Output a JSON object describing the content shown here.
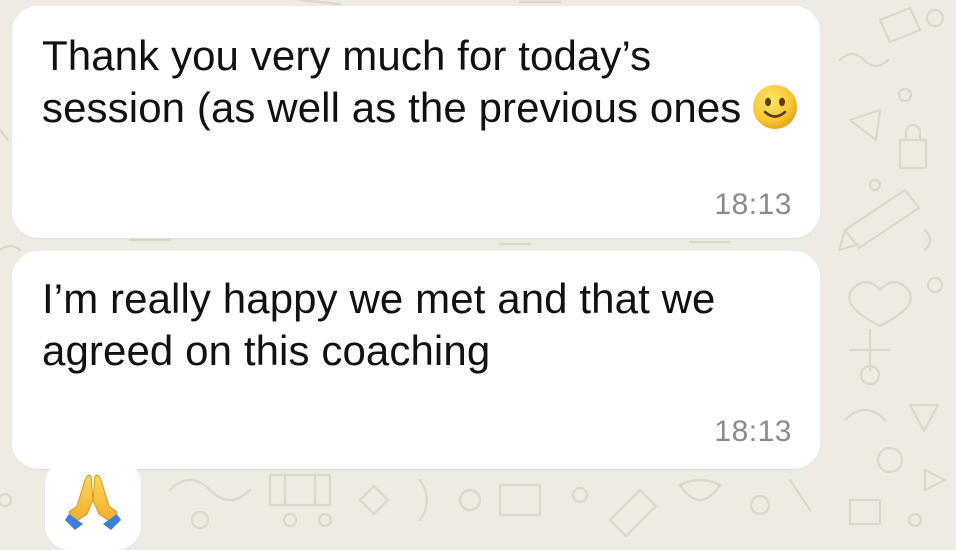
{
  "chat": {
    "background_color": "#efeae2",
    "bubble_color": "#ffffff",
    "messages": [
      {
        "text": "Thank you very much for today’s session (as well as the previous ones",
        "emoji": "slightly-smiling-face",
        "time": "18:13"
      },
      {
        "text": "I’m really happy we met and that we agreed on this coaching",
        "time": "18:13"
      },
      {
        "emoji": "folded-hands"
      }
    ]
  }
}
